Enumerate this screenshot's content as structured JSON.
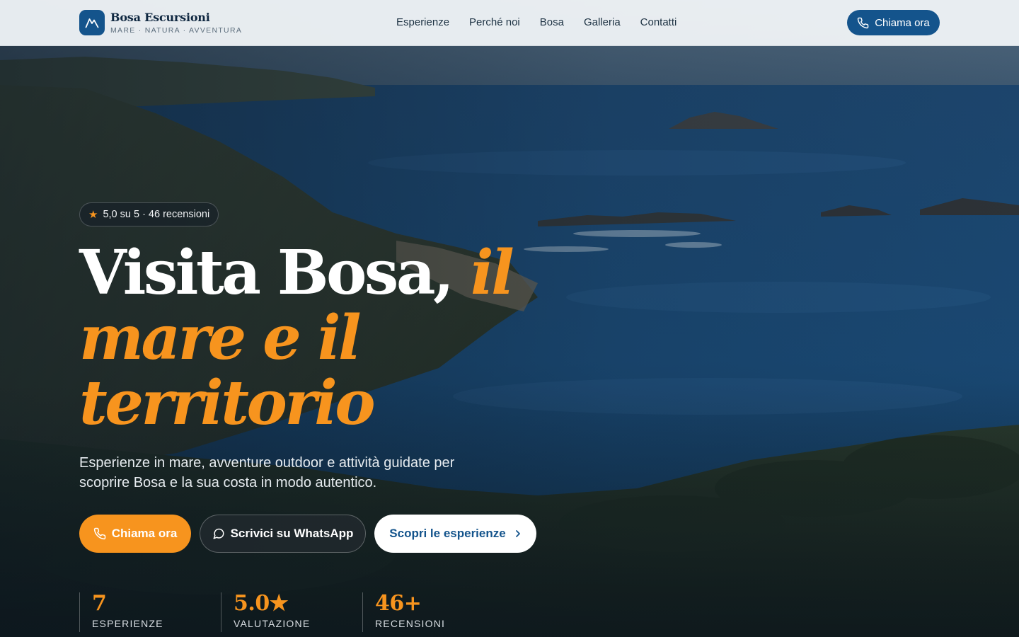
{
  "brand": {
    "name": "Bosa Escursioni",
    "tagline": "MARE · NATURA · AVVENTURA",
    "logo_icon": "mountain-icon"
  },
  "nav": {
    "items": [
      {
        "label": "Esperienze"
      },
      {
        "label": "Perché noi"
      },
      {
        "label": "Bosa"
      },
      {
        "label": "Galleria"
      },
      {
        "label": "Contatti"
      }
    ],
    "cta_label": "Chiama ora",
    "cta_icon": "phone-icon"
  },
  "hero": {
    "rating_text": "5,0 su 5 · 46 recensioni",
    "rating_icon": "star-icon",
    "title_plain": "Visita Bosa,",
    "title_accent_1": "il",
    "title_accent_2": "mare e il territorio",
    "lead": "Esperienze in mare, avventure outdoor e attività guidate per scoprire Bosa e la sua costa in modo autentico.",
    "buttons": {
      "call": "Chiama ora",
      "whatsapp": "Scrivici su WhatsApp",
      "discover": "Scopri le esperienze"
    },
    "stats": [
      {
        "value": "7",
        "label": "ESPERIENZE"
      },
      {
        "value": "5.0★",
        "label": "VALUTAZIONE"
      },
      {
        "value": "46+",
        "label": "RECENSIONI"
      }
    ]
  },
  "colors": {
    "accent": "#f7941e",
    "brand": "#14548c",
    "header_bg": "#eef2f6",
    "text_light": "#e6ebef"
  }
}
